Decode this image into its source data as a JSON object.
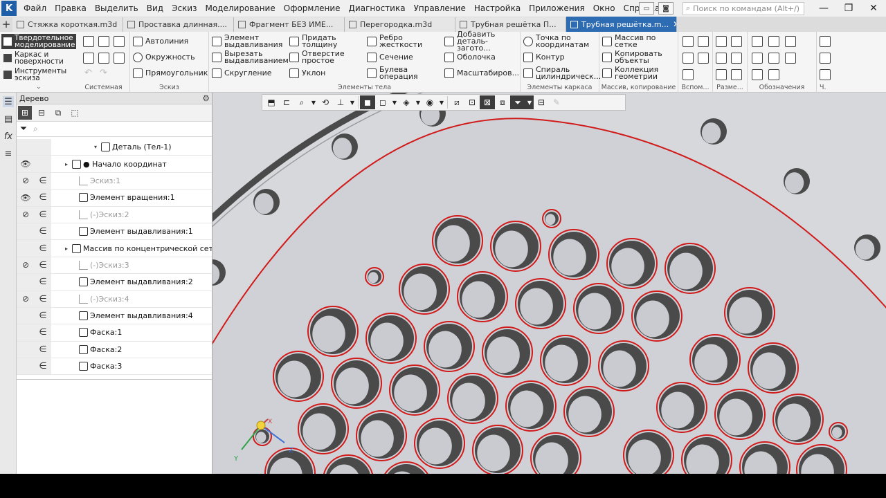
{
  "menu": {
    "items": [
      "Файл",
      "Правка",
      "Выделить",
      "Вид",
      "Эскиз",
      "Моделирование",
      "Оформление",
      "Диагностика",
      "Управление",
      "Настройка",
      "Приложения",
      "Окно",
      "Справка"
    ],
    "search_placeholder": "Поиск по командам (Alt+/)"
  },
  "tabs": [
    {
      "label": "Стяжка короткая.m3d",
      "active": false
    },
    {
      "label": "Проставка длинная....",
      "active": false
    },
    {
      "label": "Фрагмент БЕЗ ИМЕ...",
      "active": false
    },
    {
      "label": "Перегородка.m3d",
      "active": false
    },
    {
      "label": "Трубная решётка П...",
      "active": false
    },
    {
      "label": "Трубная решётка.m...",
      "active": true
    }
  ],
  "ribbon": {
    "modes": [
      {
        "label": "Твердотельное\nмоделирование",
        "active": true
      },
      {
        "label": "Каркас и\nповерхности",
        "active": false
      },
      {
        "label": "Инструменты\nэскиза",
        "active": false
      }
    ],
    "groups": {
      "system": "Системная",
      "sketch": "Эскиз",
      "body": "Элементы тела",
      "frame": "Элементы каркаса",
      "array": "Массив, копирование",
      "aux": "Вспом...",
      "dims": "Разме...",
      "notation": "Обозначения",
      "last": "Ч."
    },
    "sketch_buttons": [
      "Автолиния",
      "Окружность",
      "Прямоугольник"
    ],
    "body_buttons": [
      "Элемент\nвыдавливания",
      "Вырезать\nвыдавливанием",
      "Скругление",
      "Придать\nтолщину",
      "Отверстие\nпростое",
      "Уклон",
      "Ребро\nжесткости",
      "Сечение",
      "Булева\nоперация",
      "Добавить\nдеталь-загото...",
      "Оболочка",
      "Масштабиров..."
    ],
    "frame_buttons": [
      "Точка по\nкоординатам",
      "Контур",
      "Спираль\nцилиндрическ..."
    ],
    "array_buttons": [
      "Массив по сетке",
      "Копировать\nобъекты",
      "Коллекция\nгеометрии"
    ]
  },
  "tree": {
    "title": "Дерево",
    "rows": [
      {
        "label": "Деталь (Тел-1)",
        "eye": "",
        "link": "",
        "dim": false,
        "arrow": "▾",
        "indent": 62
      },
      {
        "label": "● Начало координат",
        "eye": "👁",
        "link": "",
        "dim": false,
        "arrow": "▸",
        "indent": 20
      },
      {
        "label": "Эскиз:1",
        "eye": "⊘",
        "link": "∈",
        "dim": true,
        "arrow": "",
        "indent": 30
      },
      {
        "label": "Элемент вращения:1",
        "eye": "👁",
        "link": "∈",
        "dim": false,
        "arrow": "",
        "indent": 30
      },
      {
        "label": "(-)Эскиз:2",
        "eye": "⊘",
        "link": "∈",
        "dim": true,
        "arrow": "",
        "indent": 30
      },
      {
        "label": "Элемент выдавливания:1",
        "eye": "",
        "link": "∈",
        "dim": false,
        "arrow": "",
        "indent": 30
      },
      {
        "label": "Массив по концентрической сетке",
        "eye": "",
        "link": "∈",
        "dim": false,
        "arrow": "▸",
        "indent": 20
      },
      {
        "label": "(-)Эскиз:3",
        "eye": "⊘",
        "link": "∈",
        "dim": true,
        "arrow": "",
        "indent": 30
      },
      {
        "label": "Элемент выдавливания:2",
        "eye": "",
        "link": "∈",
        "dim": false,
        "arrow": "",
        "indent": 30
      },
      {
        "label": "(-)Эскиз:4",
        "eye": "⊘",
        "link": "∈",
        "dim": true,
        "arrow": "",
        "indent": 30
      },
      {
        "label": "Элемент выдавливания:4",
        "eye": "",
        "link": "∈",
        "dim": false,
        "arrow": "",
        "indent": 30
      },
      {
        "label": "Фаска:1",
        "eye": "",
        "link": "∈",
        "dim": false,
        "arrow": "",
        "indent": 30
      },
      {
        "label": "Фаска:2",
        "eye": "",
        "link": "∈",
        "dim": false,
        "arrow": "",
        "indent": 30
      },
      {
        "label": "Фаска:3",
        "eye": "",
        "link": "∈",
        "dim": false,
        "arrow": "",
        "indent": 30
      }
    ]
  },
  "axes": {
    "x": "X",
    "y": "Y",
    "z": "Z"
  },
  "colors": {
    "accent": "#2d6bb3",
    "edge_highlight": "#d11a1a",
    "hole_dark": "#4a4a4a",
    "hole_light": "#c9cbd0"
  }
}
